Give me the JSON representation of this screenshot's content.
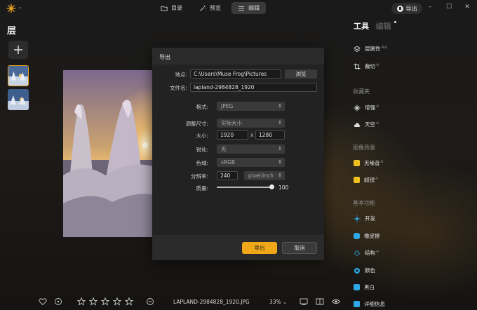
{
  "topbar": {
    "tabs": [
      {
        "label": "目录",
        "icon": "folder-icon",
        "active": false
      },
      {
        "label": "预览",
        "icon": "magic-wand-icon",
        "active": false
      },
      {
        "label": "编辑",
        "icon": "sliders-icon",
        "active": true
      }
    ],
    "export_label": "导出",
    "window_controls": [
      "minimize",
      "maximize",
      "close"
    ]
  },
  "left_panel": {
    "title": "层",
    "add_icon": "plus-icon",
    "layers": [
      {
        "name": "layer-1",
        "selected": true
      },
      {
        "name": "layer-2",
        "selected": false
      }
    ]
  },
  "dialog": {
    "title": "导出",
    "location_label": "地点:",
    "location_value": "C:\\Users\\Muse Frog\\Pictures",
    "browse_label": "浏览",
    "filename_label": "文件名:",
    "filename_value": "lapland-2984828_1920",
    "format_label": "格式:",
    "format_value": "JPEG",
    "resize_label": "调整尺寸:",
    "resize_value": "实际大小",
    "size_label": "大小:",
    "width_value": "1920",
    "times": "x",
    "height_value": "1280",
    "sharpen_label": "锐化:",
    "sharpen_value": "无",
    "colorspace_label": "色域:",
    "colorspace_value": "sRGB",
    "resolution_label": "分辨率:",
    "resolution_value": "240",
    "resolution_unit": "pixel/inch",
    "quality_label": "质量:",
    "quality_value": "100",
    "export_button": "导出",
    "cancel_button": "取消"
  },
  "right_panel": {
    "tab_tools": "工具",
    "tab_edit": "编辑",
    "items_top": [
      {
        "label": "层属性",
        "badge": "PRO",
        "icon": "layer-properties-icon"
      },
      {
        "label": "裁切",
        "badge": "AI",
        "icon": "crop-icon"
      }
    ],
    "sections": [
      {
        "title": "收藏夹",
        "items": [
          {
            "label": "增强",
            "badge": "AI",
            "icon": "enhance-icon"
          },
          {
            "label": "天空",
            "badge": "AI",
            "icon": "cloud-icon"
          }
        ]
      },
      {
        "title": "图像质量",
        "items": [
          {
            "label": "无噪音",
            "badge": "AI",
            "icon": "denoise-icon",
            "color": "#f0c020"
          },
          {
            "label": "超锐",
            "badge": "AI",
            "icon": "supersharp-icon",
            "color": "#f0c020"
          }
        ]
      },
      {
        "title": "基本功能",
        "items": [
          {
            "label": "开发",
            "badge": "",
            "icon": "sun-icon",
            "color": "#2ea8e6"
          },
          {
            "label": "橡皮擦",
            "badge": "",
            "icon": "eraser-icon",
            "color": "#2ea8e6"
          },
          {
            "label": "结构",
            "badge": "AI",
            "icon": "structure-icon",
            "color": "#2ea8e6"
          },
          {
            "label": "颜色",
            "badge": "",
            "icon": "color-icon",
            "color": "#2ea8e6"
          },
          {
            "label": "黑白",
            "badge": "",
            "icon": "bw-icon",
            "color": "#2ea8e6"
          },
          {
            "label": "详细信息",
            "badge": "",
            "icon": "details-icon",
            "color": "#2ea8e6"
          }
        ]
      }
    ]
  },
  "bottombar": {
    "filename": "LAPLAND-2984828_1920.JPG",
    "zoom": "33%",
    "rating": 0,
    "stars": 5
  },
  "colors": {
    "accent": "#f0a818",
    "tool_blue": "#2ea8e6",
    "tool_yellow": "#f0c020"
  }
}
